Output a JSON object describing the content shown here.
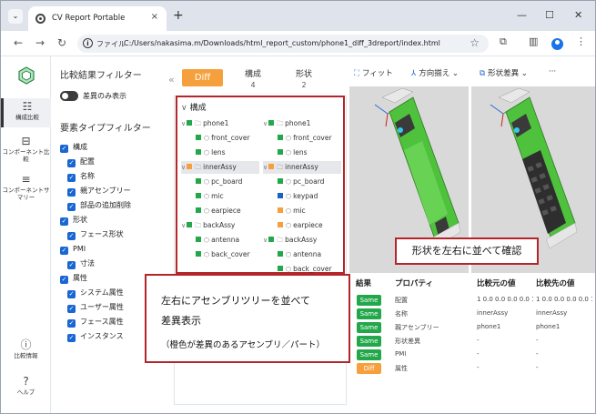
{
  "browser": {
    "tab_title": "CV Report Portable",
    "scheme_label": "ファイル",
    "url": "C:/Users/nakasima.m/Downloads/html_report_custom/phone1_diff_3dreport/index.html"
  },
  "rail": {
    "items": [
      {
        "label": "構成比較"
      },
      {
        "label": "コンポーネント比較"
      },
      {
        "label": "コンポーネントサマリー"
      },
      {
        "label": "比較情報"
      },
      {
        "label": "ヘルプ"
      }
    ]
  },
  "filters": {
    "result_title": "比較結果フィルター",
    "diff_only_label": "差異のみ表示",
    "type_title": "要素タイプフィルター",
    "items": [
      {
        "label": "構成"
      },
      {
        "label": "配置"
      },
      {
        "label": "名称"
      },
      {
        "label": "親アセンブリー"
      },
      {
        "label": "部品の追加削除"
      },
      {
        "label": "形状"
      },
      {
        "label": "フェース形状"
      },
      {
        "label": "PMI"
      },
      {
        "label": "寸法"
      },
      {
        "label": "属性"
      },
      {
        "label": "システム属性"
      },
      {
        "label": "ユーザー属性"
      },
      {
        "label": "フェース属性"
      },
      {
        "label": "インスタンス"
      }
    ]
  },
  "tabs": {
    "diff_label": "Diff",
    "kousei_label": "構成",
    "kousei_count": "4",
    "keijo_label": "形状",
    "keijo_count": "2"
  },
  "tree": {
    "header": "構成",
    "left": [
      {
        "label": "phone1",
        "color": "#22a84a"
      },
      {
        "label": "front_cover",
        "color": "#22a84a"
      },
      {
        "label": "lens",
        "color": "#22a84a"
      },
      {
        "label": "innerAssy",
        "color": "#f5a03c"
      },
      {
        "label": "pc_board",
        "color": "#22a84a"
      },
      {
        "label": "mic",
        "color": "#22a84a"
      },
      {
        "label": "earpiece",
        "color": "#22a84a"
      },
      {
        "label": "backAssy",
        "color": "#22a84a"
      },
      {
        "label": "antenna",
        "color": "#22a84a"
      },
      {
        "label": "back_cover",
        "color": "#22a84a"
      }
    ],
    "right": [
      {
        "label": "phone1",
        "color": "#22a84a"
      },
      {
        "label": "front_cover",
        "color": "#22a84a"
      },
      {
        "label": "lens",
        "color": "#22a84a"
      },
      {
        "label": "innerAssy",
        "color": "#f5a03c"
      },
      {
        "label": "pc_board",
        "color": "#22a84a"
      },
      {
        "label": "keypad",
        "color": "#1565c0"
      },
      {
        "label": "mic",
        "color": "#f5a03c"
      },
      {
        "label": "earpiece",
        "color": "#f5a03c"
      },
      {
        "label": "backAssy",
        "color": "#22a84a"
      },
      {
        "label": "antenna",
        "color": "#22a84a"
      },
      {
        "label": "back_cover",
        "color": "#22a84a"
      }
    ]
  },
  "viewer": {
    "fit_label": "フィット",
    "align_label": "方向揃え",
    "shape_diff_label": "形状差異",
    "more_label": "···"
  },
  "props": {
    "headers": {
      "result": "結果",
      "property": "プロパティ",
      "before": "比較元の値",
      "after": "比較先の値"
    },
    "rows": [
      {
        "result": "Same",
        "property": "配置",
        "before": "1 0.0 0.0 0.0 0.0 1",
        "after": "1 0.0 0.0 0.0 0.0 1"
      },
      {
        "result": "Same",
        "property": "名称",
        "before": "innerAssy",
        "after": "innerAssy"
      },
      {
        "result": "Same",
        "property": "親アセンブリー",
        "before": "phone1",
        "after": "phone1"
      },
      {
        "result": "Same",
        "property": "形状差異",
        "before": "-",
        "after": "-"
      },
      {
        "result": "Same",
        "property": "PMI",
        "before": "-",
        "after": "-"
      },
      {
        "result": "Diff",
        "property": "属性",
        "before": "-",
        "after": "-"
      }
    ]
  },
  "annotations": {
    "shape_side_by_side": "形状を左右に並べて確認",
    "tree_line1": "左右にアセンブリツリーを並べて",
    "tree_line2": "差異表示",
    "tree_line3": "（橙色が差異のあるアセンブリ／パート）"
  },
  "colors": {
    "same": "#22a84a",
    "diff": "#f5a03c",
    "added": "#1565c0",
    "callout_border": "#b3262a",
    "model_green": "#5cd44a"
  }
}
